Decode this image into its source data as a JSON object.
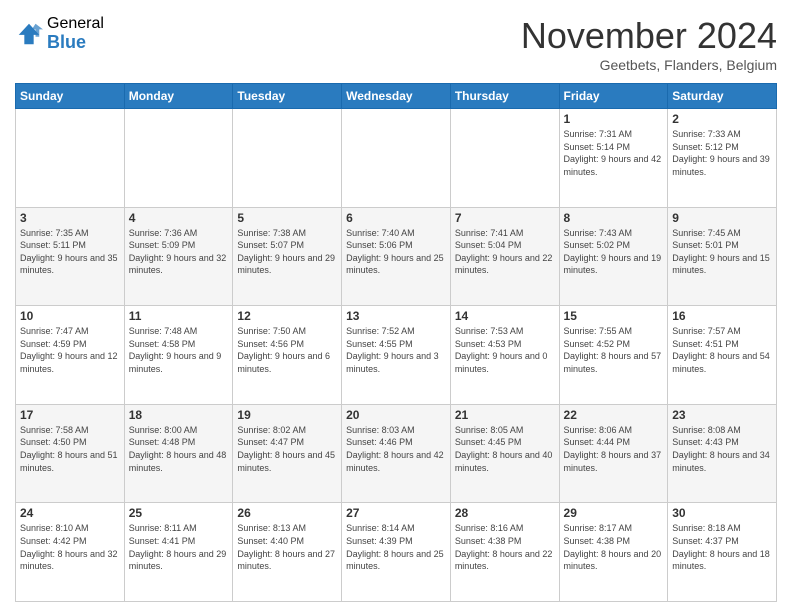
{
  "logo": {
    "general": "General",
    "blue": "Blue"
  },
  "header": {
    "month": "November 2024",
    "location": "Geetbets, Flanders, Belgium"
  },
  "weekdays": [
    "Sunday",
    "Monday",
    "Tuesday",
    "Wednesday",
    "Thursday",
    "Friday",
    "Saturday"
  ],
  "rows": [
    [
      {
        "day": "",
        "sunrise": "",
        "sunset": "",
        "daylight": ""
      },
      {
        "day": "",
        "sunrise": "",
        "sunset": "",
        "daylight": ""
      },
      {
        "day": "",
        "sunrise": "",
        "sunset": "",
        "daylight": ""
      },
      {
        "day": "",
        "sunrise": "",
        "sunset": "",
        "daylight": ""
      },
      {
        "day": "",
        "sunrise": "",
        "sunset": "",
        "daylight": ""
      },
      {
        "day": "1",
        "sunrise": "Sunrise: 7:31 AM",
        "sunset": "Sunset: 5:14 PM",
        "daylight": "Daylight: 9 hours and 42 minutes."
      },
      {
        "day": "2",
        "sunrise": "Sunrise: 7:33 AM",
        "sunset": "Sunset: 5:12 PM",
        "daylight": "Daylight: 9 hours and 39 minutes."
      }
    ],
    [
      {
        "day": "3",
        "sunrise": "Sunrise: 7:35 AM",
        "sunset": "Sunset: 5:11 PM",
        "daylight": "Daylight: 9 hours and 35 minutes."
      },
      {
        "day": "4",
        "sunrise": "Sunrise: 7:36 AM",
        "sunset": "Sunset: 5:09 PM",
        "daylight": "Daylight: 9 hours and 32 minutes."
      },
      {
        "day": "5",
        "sunrise": "Sunrise: 7:38 AM",
        "sunset": "Sunset: 5:07 PM",
        "daylight": "Daylight: 9 hours and 29 minutes."
      },
      {
        "day": "6",
        "sunrise": "Sunrise: 7:40 AM",
        "sunset": "Sunset: 5:06 PM",
        "daylight": "Daylight: 9 hours and 25 minutes."
      },
      {
        "day": "7",
        "sunrise": "Sunrise: 7:41 AM",
        "sunset": "Sunset: 5:04 PM",
        "daylight": "Daylight: 9 hours and 22 minutes."
      },
      {
        "day": "8",
        "sunrise": "Sunrise: 7:43 AM",
        "sunset": "Sunset: 5:02 PM",
        "daylight": "Daylight: 9 hours and 19 minutes."
      },
      {
        "day": "9",
        "sunrise": "Sunrise: 7:45 AM",
        "sunset": "Sunset: 5:01 PM",
        "daylight": "Daylight: 9 hours and 15 minutes."
      }
    ],
    [
      {
        "day": "10",
        "sunrise": "Sunrise: 7:47 AM",
        "sunset": "Sunset: 4:59 PM",
        "daylight": "Daylight: 9 hours and 12 minutes."
      },
      {
        "day": "11",
        "sunrise": "Sunrise: 7:48 AM",
        "sunset": "Sunset: 4:58 PM",
        "daylight": "Daylight: 9 hours and 9 minutes."
      },
      {
        "day": "12",
        "sunrise": "Sunrise: 7:50 AM",
        "sunset": "Sunset: 4:56 PM",
        "daylight": "Daylight: 9 hours and 6 minutes."
      },
      {
        "day": "13",
        "sunrise": "Sunrise: 7:52 AM",
        "sunset": "Sunset: 4:55 PM",
        "daylight": "Daylight: 9 hours and 3 minutes."
      },
      {
        "day": "14",
        "sunrise": "Sunrise: 7:53 AM",
        "sunset": "Sunset: 4:53 PM",
        "daylight": "Daylight: 9 hours and 0 minutes."
      },
      {
        "day": "15",
        "sunrise": "Sunrise: 7:55 AM",
        "sunset": "Sunset: 4:52 PM",
        "daylight": "Daylight: 8 hours and 57 minutes."
      },
      {
        "day": "16",
        "sunrise": "Sunrise: 7:57 AM",
        "sunset": "Sunset: 4:51 PM",
        "daylight": "Daylight: 8 hours and 54 minutes."
      }
    ],
    [
      {
        "day": "17",
        "sunrise": "Sunrise: 7:58 AM",
        "sunset": "Sunset: 4:50 PM",
        "daylight": "Daylight: 8 hours and 51 minutes."
      },
      {
        "day": "18",
        "sunrise": "Sunrise: 8:00 AM",
        "sunset": "Sunset: 4:48 PM",
        "daylight": "Daylight: 8 hours and 48 minutes."
      },
      {
        "day": "19",
        "sunrise": "Sunrise: 8:02 AM",
        "sunset": "Sunset: 4:47 PM",
        "daylight": "Daylight: 8 hours and 45 minutes."
      },
      {
        "day": "20",
        "sunrise": "Sunrise: 8:03 AM",
        "sunset": "Sunset: 4:46 PM",
        "daylight": "Daylight: 8 hours and 42 minutes."
      },
      {
        "day": "21",
        "sunrise": "Sunrise: 8:05 AM",
        "sunset": "Sunset: 4:45 PM",
        "daylight": "Daylight: 8 hours and 40 minutes."
      },
      {
        "day": "22",
        "sunrise": "Sunrise: 8:06 AM",
        "sunset": "Sunset: 4:44 PM",
        "daylight": "Daylight: 8 hours and 37 minutes."
      },
      {
        "day": "23",
        "sunrise": "Sunrise: 8:08 AM",
        "sunset": "Sunset: 4:43 PM",
        "daylight": "Daylight: 8 hours and 34 minutes."
      }
    ],
    [
      {
        "day": "24",
        "sunrise": "Sunrise: 8:10 AM",
        "sunset": "Sunset: 4:42 PM",
        "daylight": "Daylight: 8 hours and 32 minutes."
      },
      {
        "day": "25",
        "sunrise": "Sunrise: 8:11 AM",
        "sunset": "Sunset: 4:41 PM",
        "daylight": "Daylight: 8 hours and 29 minutes."
      },
      {
        "day": "26",
        "sunrise": "Sunrise: 8:13 AM",
        "sunset": "Sunset: 4:40 PM",
        "daylight": "Daylight: 8 hours and 27 minutes."
      },
      {
        "day": "27",
        "sunrise": "Sunrise: 8:14 AM",
        "sunset": "Sunset: 4:39 PM",
        "daylight": "Daylight: 8 hours and 25 minutes."
      },
      {
        "day": "28",
        "sunrise": "Sunrise: 8:16 AM",
        "sunset": "Sunset: 4:38 PM",
        "daylight": "Daylight: 8 hours and 22 minutes."
      },
      {
        "day": "29",
        "sunrise": "Sunrise: 8:17 AM",
        "sunset": "Sunset: 4:38 PM",
        "daylight": "Daylight: 8 hours and 20 minutes."
      },
      {
        "day": "30",
        "sunrise": "Sunrise: 8:18 AM",
        "sunset": "Sunset: 4:37 PM",
        "daylight": "Daylight: 8 hours and 18 minutes."
      }
    ]
  ]
}
